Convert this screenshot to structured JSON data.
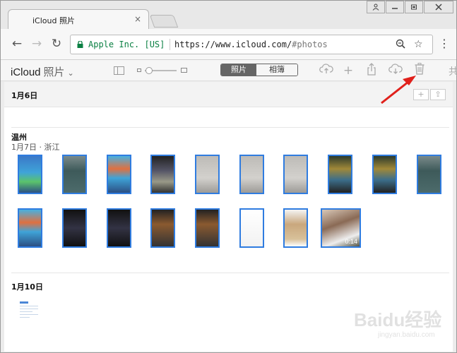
{
  "browser": {
    "tab_title": "iCloud 照片",
    "tab_close_glyph": "×",
    "window_buttons": [
      "user-icon",
      "minimize-icon",
      "restore-icon",
      "close-icon"
    ],
    "secure_label": "Apple Inc. [US]",
    "url_host": "https://www.icloud.com/",
    "url_path": "#photos"
  },
  "app": {
    "brand": "iCloud",
    "app_name": "照片",
    "view_tabs": [
      "照片",
      "相簿"
    ],
    "active_view": "照片",
    "more_label": "共"
  },
  "sections": [
    {
      "date": "1月6日"
    },
    {
      "place": "温州",
      "date": "1月7日",
      "dot": "·",
      "region": "浙江"
    },
    {
      "date": "1月10日"
    }
  ],
  "video_duration": "0:14",
  "watermark": {
    "brand": "Baidu经验",
    "url": "jingyan.baidu.com"
  },
  "colors": {
    "accent": "#2f7ce0",
    "secure_green": "#0b8043",
    "arrow_red": "#e0201b"
  }
}
